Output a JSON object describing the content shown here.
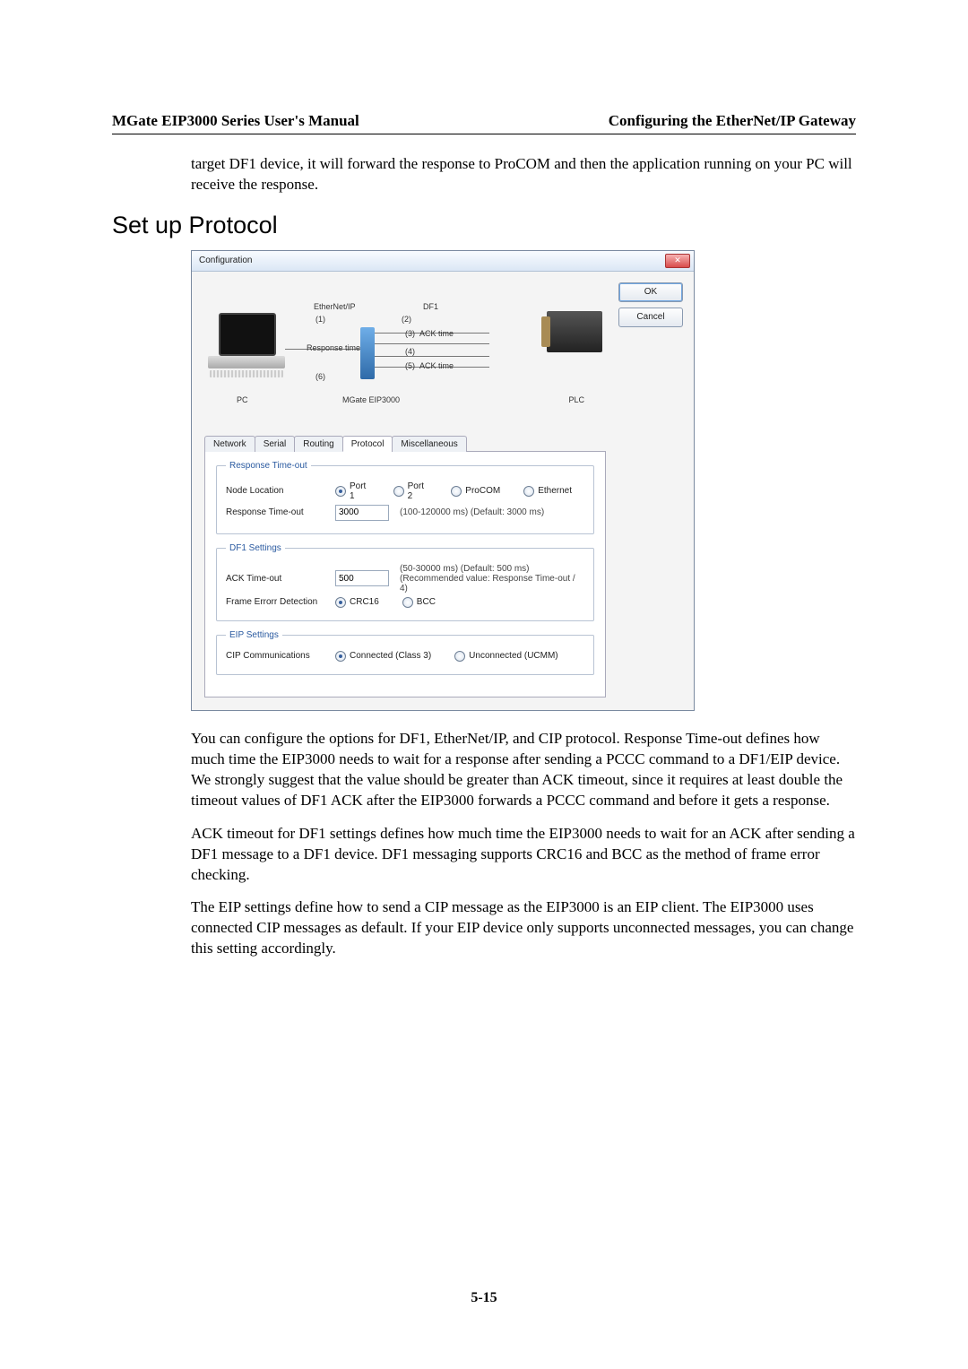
{
  "header": {
    "left": "MGate EIP3000 Series User's Manual",
    "right": "Configuring the EtherNet/IP Gateway"
  },
  "intro": "target DF1 device, it will forward the response to ProCOM and then the application running on your PC will receive the response.",
  "heading": "Set up Protocol",
  "dialog": {
    "title": "Configuration",
    "ok": "OK",
    "cancel": "Cancel",
    "diagram": {
      "ethlabel": "EtherNet/IP",
      "df1label": "DF1",
      "resplabel": "Response time",
      "acklabel": "ACK time",
      "n1": "(1)",
      "n2": "(2)",
      "n3": "(3)",
      "n4": "(4)",
      "n5": "(5)",
      "n6": "(6)",
      "pc": "PC",
      "gateway": "MGate EIP3000",
      "plc": "PLC"
    },
    "tabs": {
      "network": "Network",
      "serial": "Serial",
      "routing": "Routing",
      "protocol": "Protocol",
      "misc": "Miscellaneous"
    },
    "resp": {
      "legend": "Response Time-out",
      "nodeloc_label": "Node Location",
      "port1": "Port 1",
      "port2": "Port 2",
      "procom": "ProCOM",
      "eth": "Ethernet",
      "rt_label": "Response Time-out",
      "rt_value": "3000",
      "rt_hint": "(100-120000 ms) (Default: 3000 ms)"
    },
    "df1": {
      "legend": "DF1 Settings",
      "ack_label": "ACK Time-out",
      "ack_value": "500",
      "ack_hint1": "(50-30000 ms) (Default: 500 ms)",
      "ack_hint2": "(Recommended value: Response Time-out / 4)",
      "fed_label": "Frame Errorr Detection",
      "crc": "CRC16",
      "bcc": "BCC"
    },
    "eip": {
      "legend": "EIP Settings",
      "cip_label": "CIP Communications",
      "conn": "Connected (Class 3)",
      "unconn": "Unconnected (UCMM)"
    }
  },
  "p1": "You can configure the options for DF1, EtherNet/IP, and CIP protocol. Response Time-out defines how much time the EIP3000 needs to wait for a response after sending a PCCC command to a DF1/EIP device. We strongly suggest that the value should be greater than ACK timeout, since it requires at least double the timeout values of DF1 ACK after the EIP3000 forwards a PCCC command and before it gets a response.",
  "p2": "ACK timeout for DF1 settings defines how much time the EIP3000 needs to wait for an ACK after sending a DF1 message to a DF1 device. DF1 messaging supports CRC16 and BCC as the method of frame error checking.",
  "p3": "The EIP settings define how to send a CIP message as the EIP3000 is an EIP client. The EIP3000 uses connected CIP messages as default. If your EIP device only supports unconnected messages, you can change this setting accordingly.",
  "pagefoot": "5-15"
}
